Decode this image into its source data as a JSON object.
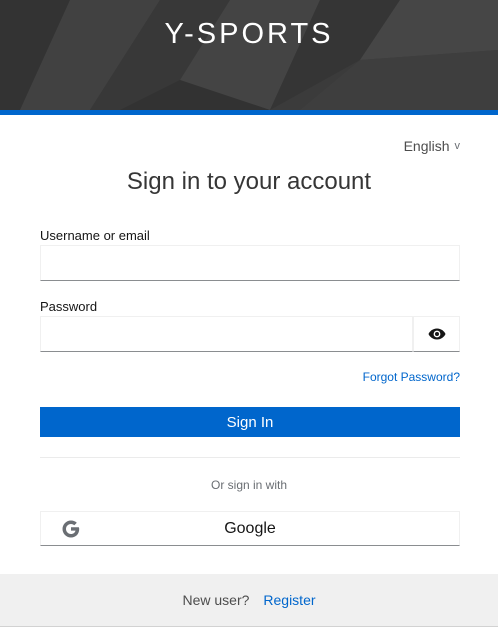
{
  "header": {
    "brand": "Y-SPORTS",
    "accent_color": "#0066cc"
  },
  "locale": {
    "selected": "English",
    "chevron": "v"
  },
  "form": {
    "title": "Sign in to your account",
    "username": {
      "label": "Username or email",
      "value": "",
      "placeholder": ""
    },
    "password": {
      "label": "Password",
      "value": "",
      "placeholder": "",
      "toggle_icon": "eye-icon"
    },
    "forgot_password": "Forgot Password?",
    "submit_label": "Sign In"
  },
  "social": {
    "divider_text": "Or sign in with",
    "providers": [
      {
        "name": "Google",
        "icon": "google-icon"
      }
    ]
  },
  "footer": {
    "new_user_text": "New user?",
    "register_link": "Register"
  }
}
